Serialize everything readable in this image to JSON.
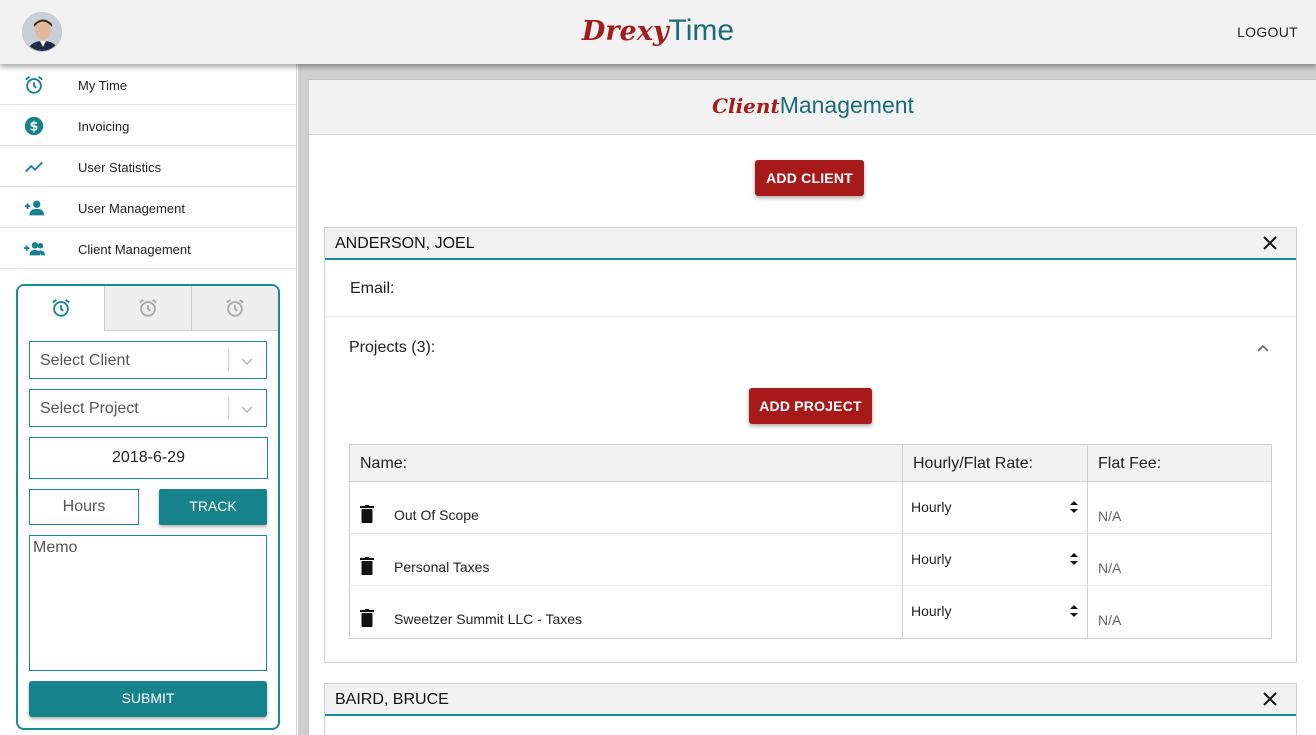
{
  "header": {
    "brand_part1": "Drexy",
    "brand_part2": "Time",
    "logout_label": "LOGOUT"
  },
  "sidebar": {
    "items": [
      {
        "label": "My Time",
        "icon": "alarm-clock-icon"
      },
      {
        "label": "Invoicing",
        "icon": "dollar-circle-icon"
      },
      {
        "label": "User Statistics",
        "icon": "trending-up-icon"
      },
      {
        "label": "User Management",
        "icon": "person-add-icon"
      },
      {
        "label": "Client Management",
        "icon": "group-add-icon"
      }
    ]
  },
  "timer": {
    "tabs": [
      "timer-1",
      "timer-2",
      "timer-3"
    ],
    "active_tab": 0,
    "client_placeholder": "Select Client",
    "project_placeholder": "Select Project",
    "date_value": "2018-6-29",
    "hours_placeholder": "Hours",
    "track_label": "TRACK",
    "memo_placeholder": "Memo",
    "submit_label": "SUBMIT"
  },
  "main": {
    "title_part1": "Client",
    "title_part2": "Management",
    "add_client_label": "ADD CLIENT",
    "clients": [
      {
        "name": "ANDERSON, JOEL",
        "email_label": "Email:",
        "projects_label": "Projects (3):",
        "add_project_label": "ADD PROJECT",
        "columns": [
          "Name:",
          "Hourly/Flat Rate:",
          "Flat Fee:"
        ],
        "projects": [
          {
            "name": "Out Of Scope",
            "rate": "Hourly",
            "fee": "N/A"
          },
          {
            "name": "Personal Taxes",
            "rate": "Hourly",
            "fee": "N/A"
          },
          {
            "name": "Sweetzer Summit LLC - Taxes",
            "rate": "Hourly",
            "fee": "N/A"
          }
        ]
      },
      {
        "name": "BAIRD, BRUCE"
      }
    ]
  },
  "colors": {
    "brand_red": "#a51c1c",
    "brand_teal": "#1e6b78",
    "accent_teal": "#16838c",
    "button_red": "#a81a1a"
  }
}
